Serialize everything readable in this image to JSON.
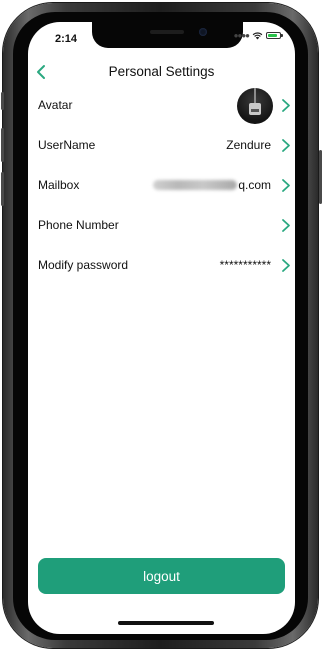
{
  "status_bar": {
    "time": "2:14",
    "battery_level": 0.8,
    "icons": [
      "signal-icon",
      "wifi-icon",
      "battery-charging-icon"
    ]
  },
  "nav": {
    "title": "Personal Settings",
    "back_icon": "chevron-left-icon"
  },
  "rows": [
    {
      "label": "Avatar",
      "value": ""
    },
    {
      "label": "UserName",
      "value": "Zendure"
    },
    {
      "label": "Mailbox",
      "value": "q.com",
      "value_obscured": true
    },
    {
      "label": "Phone Number",
      "value": ""
    },
    {
      "label": "Modify password",
      "value": "***********"
    }
  ],
  "logout_label": "logout",
  "colors": {
    "accent": "#1f9e7a",
    "chevron": "#2aa880"
  }
}
